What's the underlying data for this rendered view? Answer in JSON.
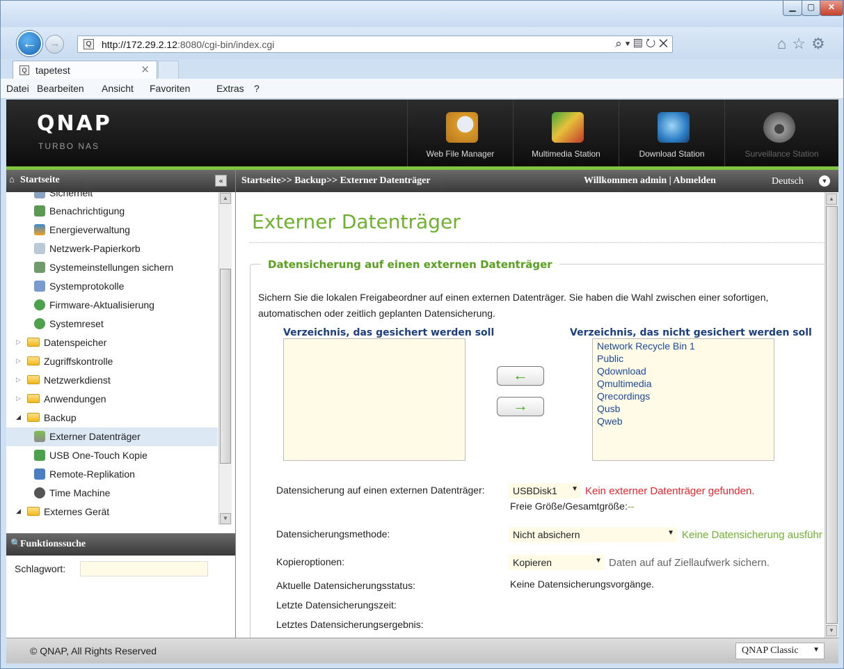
{
  "browser": {
    "url_host": "http://172.29.2.12",
    "url_rest": ":8080/cgi-bin/index.cgi",
    "tab_title": "tapetest",
    "menu": [
      "Datei",
      "Bearbeiten",
      "Ansicht",
      "Favoriten",
      "Extras",
      "?"
    ]
  },
  "header": {
    "logo": "QNAP",
    "subtitle": "TURBO NAS",
    "apps": [
      "Web File Manager",
      "Multimedia Station",
      "Download Station",
      "Surveillance Station"
    ]
  },
  "sidebar": {
    "title": "Startseite",
    "items": [
      {
        "label": "Sicherheit"
      },
      {
        "label": "Benachrichtigung"
      },
      {
        "label": "Energieverwaltung"
      },
      {
        "label": "Netzwerk-Papierkorb"
      },
      {
        "label": "Systemeinstellungen sichern"
      },
      {
        "label": "Systemprotokolle"
      },
      {
        "label": "Firmware-Aktualisierung"
      },
      {
        "label": "Systemreset"
      },
      {
        "label": "Datenspeicher"
      },
      {
        "label": "Zugriffskontrolle"
      },
      {
        "label": "Netzwerkdienst"
      },
      {
        "label": "Anwendungen"
      },
      {
        "label": "Backup"
      },
      {
        "label": "Externer Datenträger"
      },
      {
        "label": "USB One-Touch Kopie"
      },
      {
        "label": "Remote-Replikation"
      },
      {
        "label": "Time Machine"
      },
      {
        "label": "Externes Gerät"
      }
    ],
    "search_title": "Funktionssuche",
    "keyword_label": "Schlagwort:"
  },
  "topbar": {
    "breadcrumb": "Startseite>> Backup>> Externer Datenträger",
    "welcome": "Willkommen admin | Abmelden",
    "language": "Deutsch"
  },
  "main": {
    "title": "Externer Datenträger",
    "section": "Datensicherung auf einen externen Datenträger",
    "description": "Sichern Sie die lokalen Freigabeordner auf einen externen Datenträger. Sie haben die Wahl zwischen einer sofortigen, automatischen oder zeitlich geplanten Datensicherung.",
    "left_list_label": "Verzeichnis, das gesichert werden soll",
    "right_list_label": "Verzeichnis, das nicht gesichert werden soll",
    "right_list": [
      "Network Recycle Bin 1",
      "Public",
      "Qdownload",
      "Qmultimedia",
      "Qrecordings",
      "Qusb",
      "Qweb"
    ],
    "fields": {
      "target_label": "Datensicherung auf einen externen Datenträger:",
      "target_value": "USBDisk1",
      "target_error": "Kein externer Datenträger gefunden.",
      "free_size": "Freie Größe/Gesamtgröße:",
      "free_size_value": "--",
      "method_label": "Datensicherungsmethode:",
      "method_value": "Nicht absichern",
      "method_note": "Keine Datensicherung ausführ",
      "copy_label": "Kopieroptionen:",
      "copy_value": "Kopieren",
      "copy_note": "Daten auf auf Ziellaufwerk sichern.",
      "status_label": "Aktuelle Datensicherungsstatus:",
      "status_value": "Keine Datensicherungsvorgänge.",
      "last_time_label": "Letzte Datensicherungszeit:",
      "last_result_label": "Letztes Datensicherungsergebnis:"
    }
  },
  "footer": {
    "copyright": "© QNAP, All Rights Reserved",
    "theme": "QNAP Classic"
  },
  "colors": {
    "accent_green": "#6db12e",
    "error_red": "#e8262b",
    "link_blue": "#1a4a9c",
    "field_bg": "#fffbe6"
  }
}
